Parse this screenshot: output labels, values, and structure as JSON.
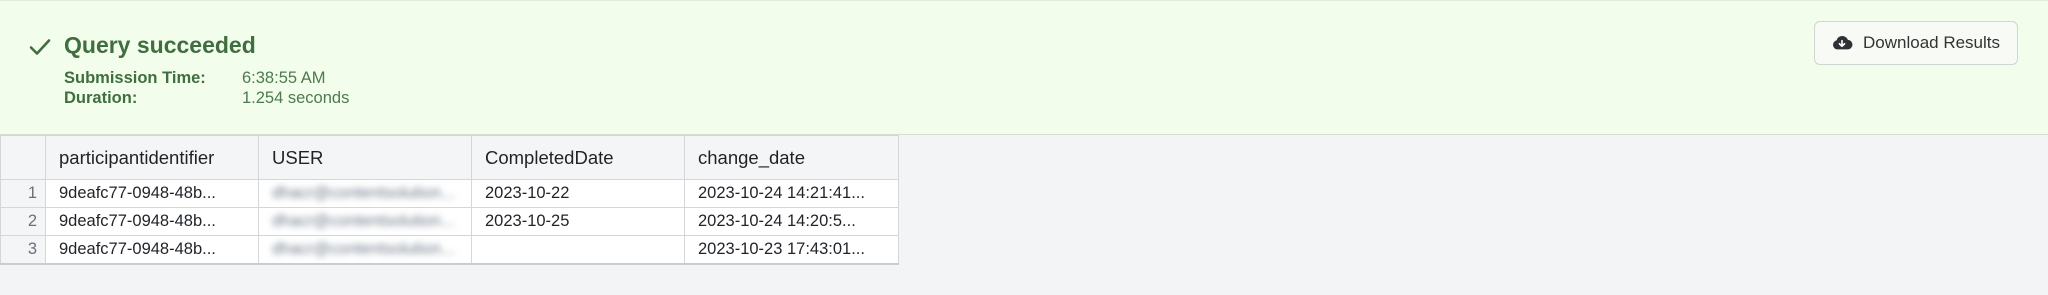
{
  "status": {
    "title": "Query succeeded",
    "icon": "check-icon",
    "color": "#3f6e3f",
    "background": "#f3fdec",
    "submission_time_label": "Submission Time:",
    "submission_time": "6:38:55 AM",
    "duration_label": "Duration:",
    "duration": "1.254 seconds"
  },
  "download": {
    "label": "Download Results",
    "icon": "cloud-download-icon"
  },
  "table": {
    "columns": [
      "participantidentifier",
      "USER",
      "CompletedDate",
      "change_date"
    ],
    "rows": [
      {
        "index": "1",
        "participantidentifier": "9deafc77-0948-48b...",
        "user": "dhacr@contentsolution...",
        "completed_date": "2023-10-22",
        "change_date": "2023-10-24 14:21:41..."
      },
      {
        "index": "2",
        "participantidentifier": "9deafc77-0948-48b...",
        "user": "dhacr@contentsolution...",
        "completed_date": "2023-10-25",
        "change_date": "2023-10-24 14:20:5..."
      },
      {
        "index": "3",
        "participantidentifier": "9deafc77-0948-48b...",
        "user": "dhacr@contentsolution...",
        "completed_date": "",
        "change_date": "2023-10-23 17:43:01..."
      }
    ]
  }
}
